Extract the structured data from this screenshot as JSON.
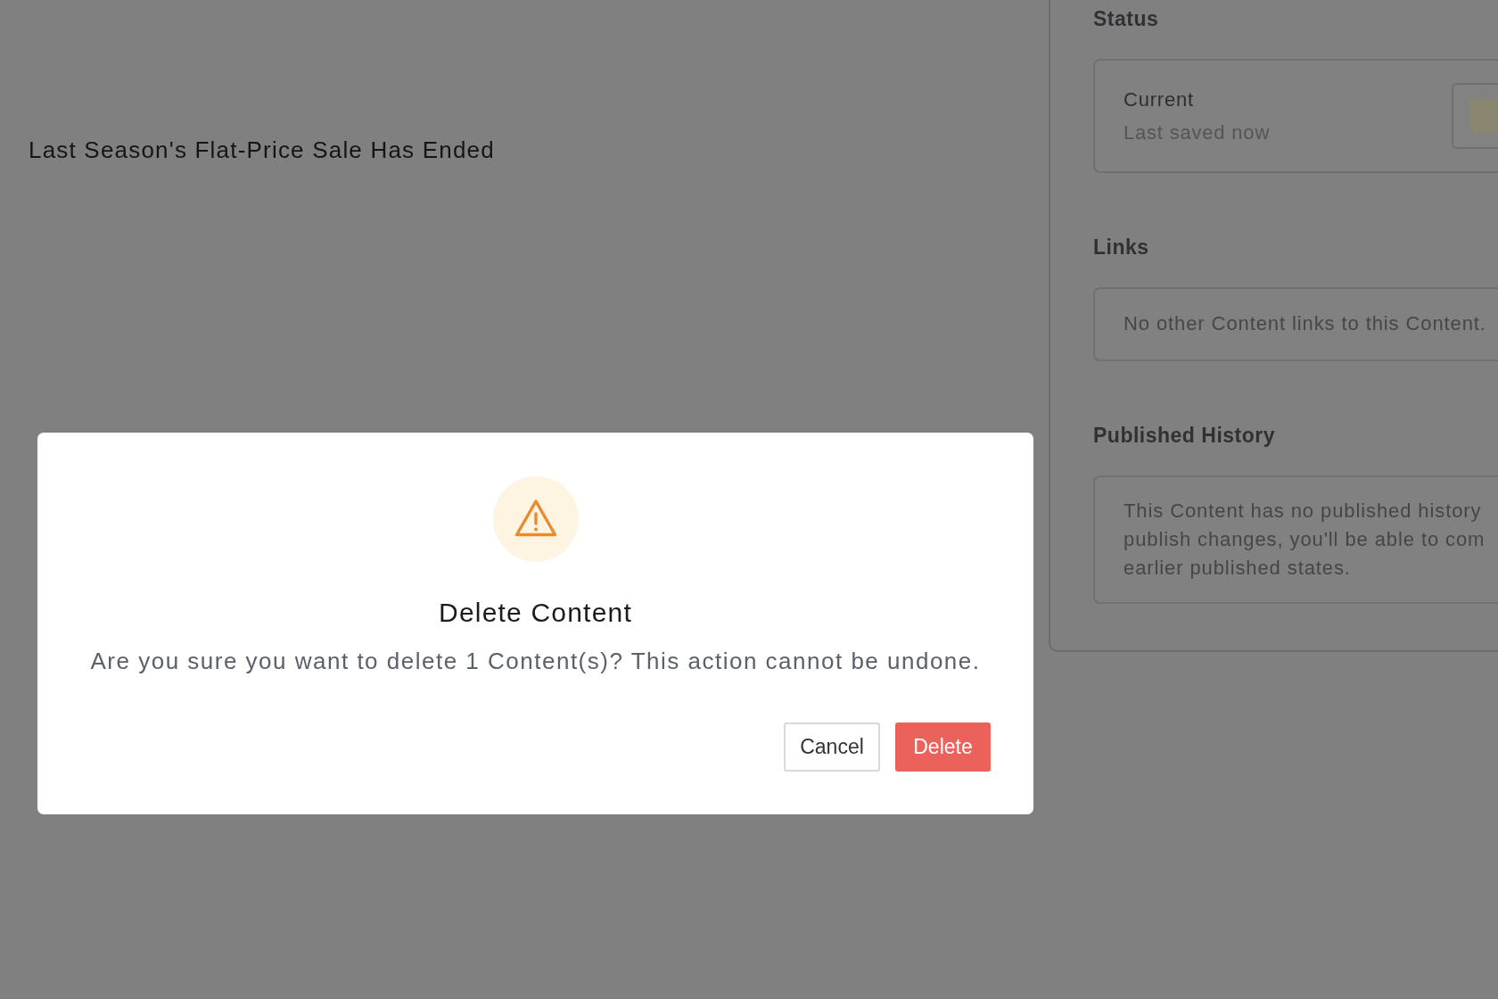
{
  "page": {
    "title": "Last Season's Flat-Price Sale Has Ended"
  },
  "sidebar": {
    "sections": [
      {
        "kind": "status",
        "heading": "Status",
        "label": "Current",
        "detail": "Last saved now"
      },
      {
        "kind": "note",
        "heading": "Links",
        "lines": [
          "No other Content links to this Content."
        ]
      },
      {
        "kind": "note",
        "heading": "Published History",
        "lines": [
          "This Content has no published history",
          "publish changes, you'll be able to com",
          "earlier published states."
        ]
      }
    ]
  },
  "dialog": {
    "title": "Delete Content",
    "message": "Are you sure you want to delete 1 Content(s)? This action cannot be undone.",
    "buttons": [
      {
        "label": "Cancel",
        "kind": "secondary"
      },
      {
        "label": "Delete",
        "kind": "danger"
      }
    ]
  }
}
